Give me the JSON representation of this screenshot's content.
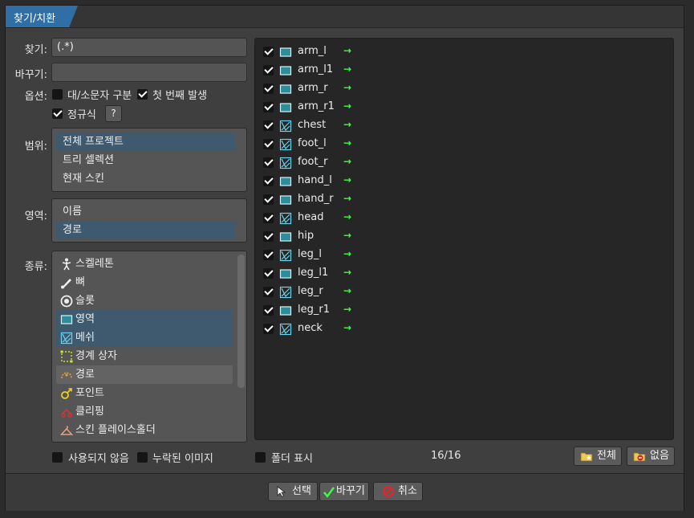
{
  "window": {
    "title": "찾기/치환"
  },
  "find": {
    "label": "찾기:",
    "value": "(.*)"
  },
  "replace": {
    "label": "바꾸기:",
    "value": ""
  },
  "options": {
    "label": "옵션:",
    "case_sensitive": {
      "label": "대/소문자 구분",
      "checked": false
    },
    "first_occurrence": {
      "label": "첫 번째 발생",
      "checked": true
    },
    "regex": {
      "label": "정규식",
      "checked": true
    },
    "help_label": "?"
  },
  "scope": {
    "label": "범위:",
    "items": [
      "전체 프로젝트",
      "트리 셀렉션",
      "현재 스킨"
    ],
    "selected": 0
  },
  "area": {
    "label": "영역:",
    "items": [
      "이름",
      "경로"
    ],
    "selected": 1
  },
  "types": {
    "label": "종류:",
    "items": [
      {
        "label": "스켈레톤",
        "icon": "skeleton-icon"
      },
      {
        "label": "뼈",
        "icon": "bone-icon"
      },
      {
        "label": "슬롯",
        "icon": "slot-icon"
      },
      {
        "label": "영역",
        "icon": "region-icon"
      },
      {
        "label": "메쉬",
        "icon": "mesh-icon"
      },
      {
        "label": "경계 상자",
        "icon": "bounding-box-icon"
      },
      {
        "label": "경로",
        "icon": "path-icon"
      },
      {
        "label": "포인트",
        "icon": "point-icon"
      },
      {
        "label": "클리핑",
        "icon": "clipping-icon"
      },
      {
        "label": "스킨 플레이스홀더",
        "icon": "skin-placeholder-icon"
      }
    ]
  },
  "unused": {
    "label": "사용되지 않음",
    "checked": false
  },
  "missing": {
    "label": "누락된 이미지",
    "checked": false
  },
  "results": {
    "rows": [
      {
        "name": "arm_l",
        "icon": "region-icon"
      },
      {
        "name": "arm_l1",
        "icon": "region-icon"
      },
      {
        "name": "arm_r",
        "icon": "region-icon"
      },
      {
        "name": "arm_r1",
        "icon": "region-icon"
      },
      {
        "name": "chest",
        "icon": "mesh-icon"
      },
      {
        "name": "foot_l",
        "icon": "mesh-icon"
      },
      {
        "name": "foot_r",
        "icon": "mesh-icon"
      },
      {
        "name": "hand_l",
        "icon": "region-icon"
      },
      {
        "name": "hand_r",
        "icon": "region-icon"
      },
      {
        "name": "head",
        "icon": "mesh-icon"
      },
      {
        "name": "hip",
        "icon": "region-icon"
      },
      {
        "name": "leg_l",
        "icon": "mesh-icon"
      },
      {
        "name": "leg_l1",
        "icon": "region-icon"
      },
      {
        "name": "leg_r",
        "icon": "mesh-icon"
      },
      {
        "name": "leg_r1",
        "icon": "region-icon"
      },
      {
        "name": "neck",
        "icon": "mesh-icon"
      }
    ],
    "arrow_glyph": "→",
    "arrow_color": "#3cff3c"
  },
  "show_folders": {
    "label": "폴더 표시",
    "checked": false
  },
  "count": "16/16",
  "select_all_label": "전체",
  "select_none_label": "없음",
  "footer": {
    "select_label": "선택",
    "replace_label": "바꾸기",
    "cancel_label": "취소"
  },
  "colors": {
    "accent": "#2f6fa6",
    "selection": "#3f5a6e",
    "check_green": "#3cff3c",
    "cancel_red": "#e0262b"
  }
}
